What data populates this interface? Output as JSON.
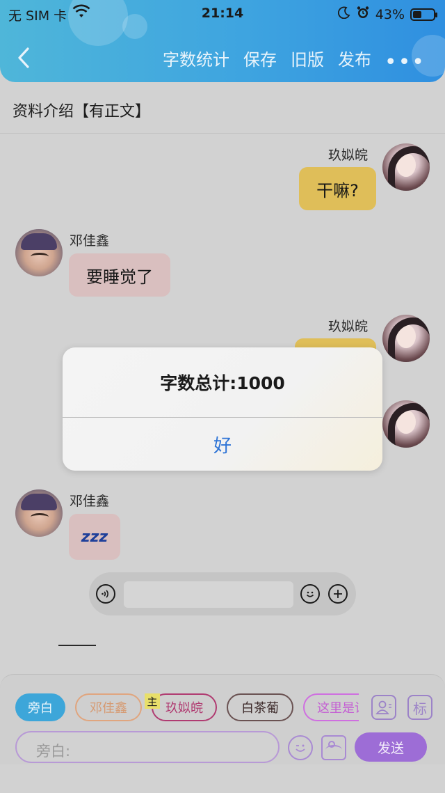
{
  "status_bar": {
    "carrier": "无 SIM 卡",
    "time": "21:14",
    "battery_percent_text": "43%",
    "battery_level": 0.43,
    "icons": [
      "wifi-icon",
      "moon-icon",
      "alarm-icon",
      "battery-icon"
    ]
  },
  "header": {
    "actions": [
      "字数统计",
      "保存",
      "旧版",
      "发布"
    ],
    "more": "•••",
    "accent_color": "#3ea4e0"
  },
  "page_title": "资料介绍【有正文】",
  "messages": [
    {
      "side": "right",
      "sender": "玖姒皖",
      "text": "干嘛?",
      "bubble_color": "#dfbe59"
    },
    {
      "side": "left",
      "sender": "邓佳鑫",
      "text": "要睡觉了",
      "bubble_color": "#d9bfbf"
    },
    {
      "side": "right",
      "sender": "玖姒皖",
      "text": "",
      "bubble_color": "#dfbe59"
    },
    {
      "side": "right",
      "sender": "",
      "text": "",
      "bubble_color": "#dfbe59"
    },
    {
      "side": "left",
      "sender": "邓佳鑫",
      "text": "zzz",
      "bubble_color": "#d9bfbf"
    }
  ],
  "dialog": {
    "title": "字数总计:1000",
    "ok_label": "好"
  },
  "composer": {
    "role_chips": [
      "旁白",
      "邓佳鑫",
      "玖姒皖",
      "白茶葡",
      "这里是请"
    ],
    "owner_badge": "主",
    "mark_button": "标",
    "placeholder": "旁白:",
    "send_label": "发送"
  }
}
